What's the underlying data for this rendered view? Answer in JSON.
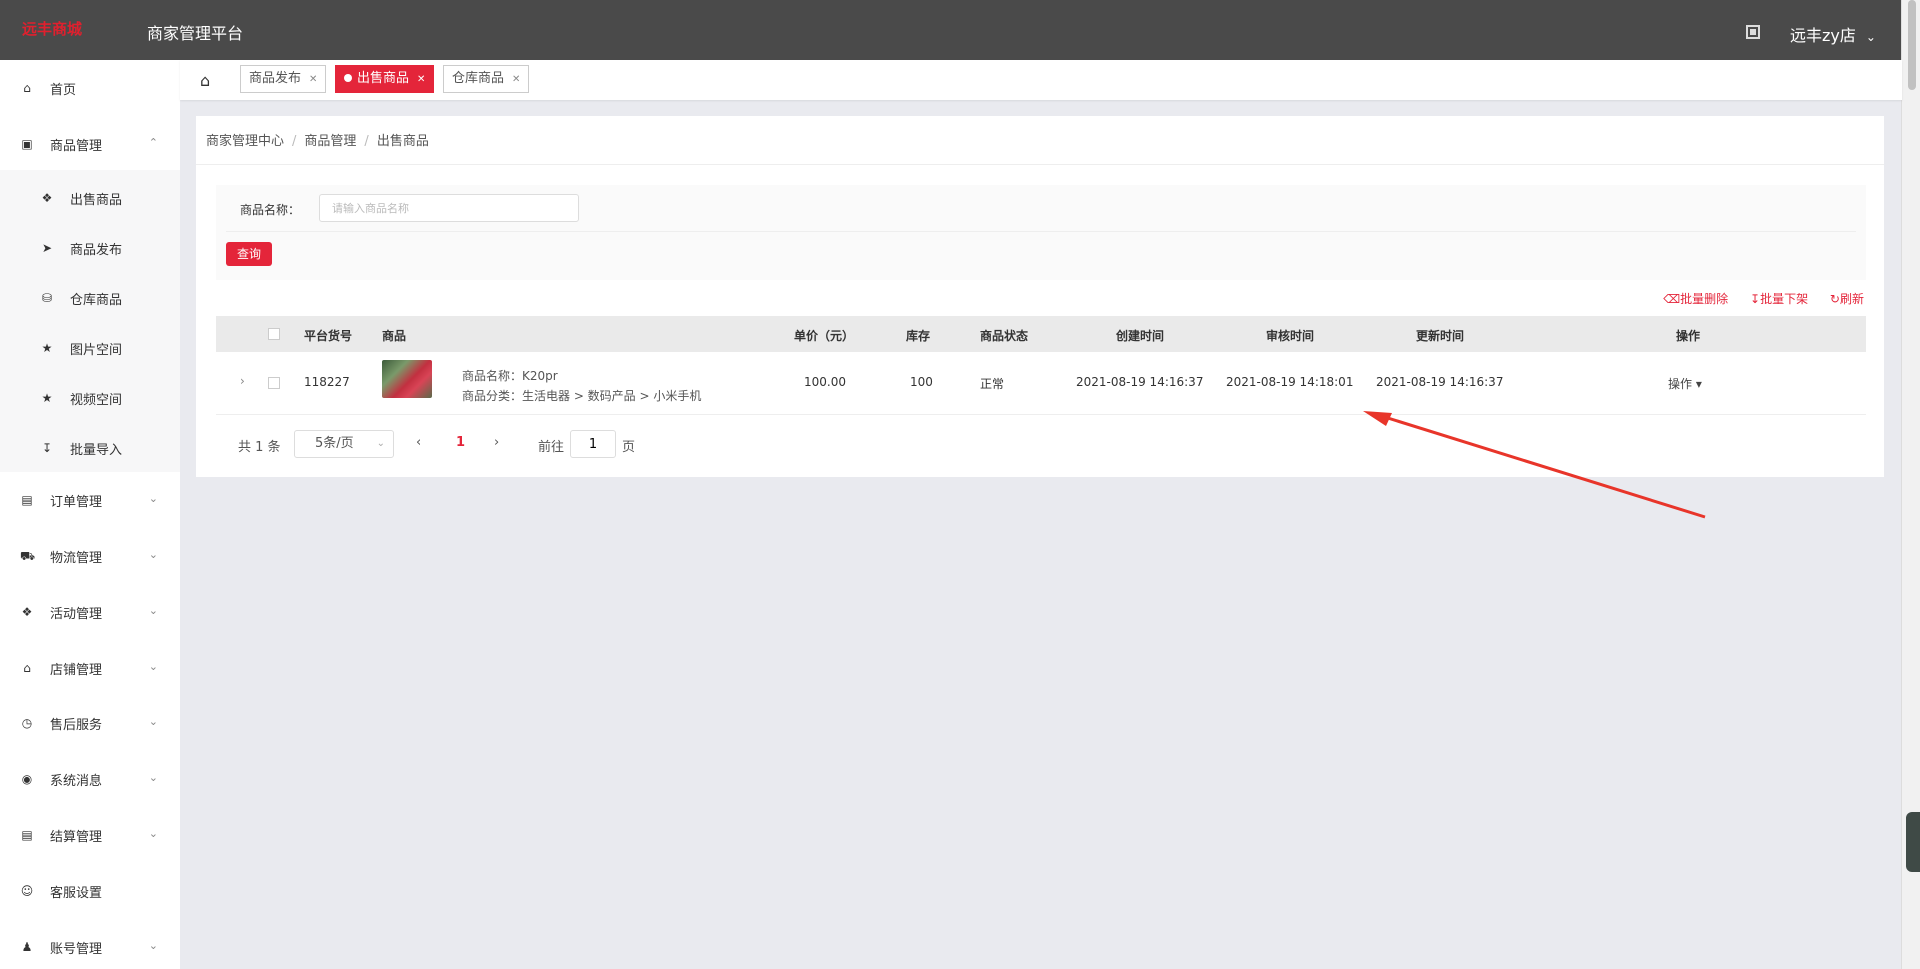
{
  "header": {
    "logo_text": "远丰商城",
    "app_title": "商家管理平台",
    "shop_name": "远丰zy店"
  },
  "sidebar": {
    "items": [
      {
        "label": "首页",
        "icon": "home-icon"
      },
      {
        "label": "商品管理",
        "icon": "goods-icon",
        "expanded": true
      },
      {
        "label": "订单管理",
        "icon": "order-icon"
      },
      {
        "label": "物流管理",
        "icon": "truck-icon"
      },
      {
        "label": "活动管理",
        "icon": "tag-icon"
      },
      {
        "label": "店铺管理",
        "icon": "store-icon"
      },
      {
        "label": "售后服务",
        "icon": "service-icon"
      },
      {
        "label": "系统消息",
        "icon": "message-icon"
      },
      {
        "label": "结算管理",
        "icon": "bill-icon"
      },
      {
        "label": "客服设置",
        "icon": "support-icon"
      },
      {
        "label": "账号管理",
        "icon": "account-icon"
      }
    ],
    "sub_items": [
      {
        "label": "出售商品",
        "icon": "price-tag-icon"
      },
      {
        "label": "商品发布",
        "icon": "send-icon"
      },
      {
        "label": "仓库商品",
        "icon": "warehouse-icon"
      },
      {
        "label": "图片空间",
        "icon": "star-icon"
      },
      {
        "label": "视频空间",
        "icon": "star-icon"
      },
      {
        "label": "批量导入",
        "icon": "import-icon"
      }
    ]
  },
  "tabs": [
    {
      "label": "商品发布",
      "active": false
    },
    {
      "label": "出售商品",
      "active": true
    },
    {
      "label": "仓库商品",
      "active": false
    }
  ],
  "breadcrumb": [
    "商家管理中心",
    "商品管理",
    "出售商品"
  ],
  "filter": {
    "label": "商品名称：",
    "placeholder": "请输入商品名称",
    "query_button": "查询"
  },
  "batch_actions": {
    "delete": "批量删除",
    "offline": "批量下架",
    "refresh": "刷新"
  },
  "table": {
    "headers": [
      "平台货号",
      "商品",
      "单价（元）",
      "库存",
      "商品状态",
      "创建时间",
      "审核时间",
      "更新时间",
      "操作"
    ],
    "rows": [
      {
        "sku": "118227",
        "name_label": "商品名称：K20pr",
        "category_label": "商品分类：生活电器 > 数码产品 > 小米手机",
        "price": "100.00",
        "stock": "100",
        "status": "正常",
        "created": "2021-08-19 14:16:37",
        "reviewed": "2021-08-19 14:18:01",
        "updated": "2021-08-19 14:16:37",
        "action": "操作"
      }
    ]
  },
  "pagination": {
    "total": "共 1 条",
    "page_size": "5条/页",
    "current_page": "1",
    "goto_label": "前往",
    "goto_value": "1",
    "page_unit": "页"
  },
  "colors": {
    "accent": "#e4253a",
    "header_bg": "#4a4a4a",
    "annotation_arrow": "#e8352a"
  }
}
